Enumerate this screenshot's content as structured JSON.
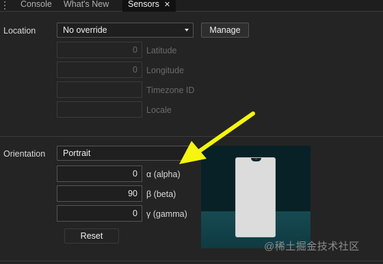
{
  "tabs": [
    {
      "label": "Console"
    },
    {
      "label": "What's New"
    },
    {
      "label": "Sensors",
      "active": true,
      "close": "✕"
    }
  ],
  "location": {
    "label": "Location",
    "select_value": "No override",
    "manage_label": "Manage",
    "fields": [
      {
        "value": "0",
        "label": "Latitude"
      },
      {
        "value": "0",
        "label": "Longitude"
      },
      {
        "value": "",
        "label": "Timezone ID"
      },
      {
        "value": "",
        "label": "Locale"
      }
    ]
  },
  "orientation": {
    "label": "Orientation",
    "select_value": "Portrait",
    "fields": [
      {
        "value": "0",
        "label": "α (alpha)"
      },
      {
        "value": "90",
        "label": "β (beta)"
      },
      {
        "value": "0",
        "label": "γ (gamma)"
      }
    ],
    "reset_label": "Reset"
  },
  "annotation": {
    "arrow_color": "#f5f50f"
  },
  "watermark": "@稀土掘金技术社区",
  "colors": {
    "preview_bg": "#082126",
    "phone": "#dcdcdc"
  }
}
